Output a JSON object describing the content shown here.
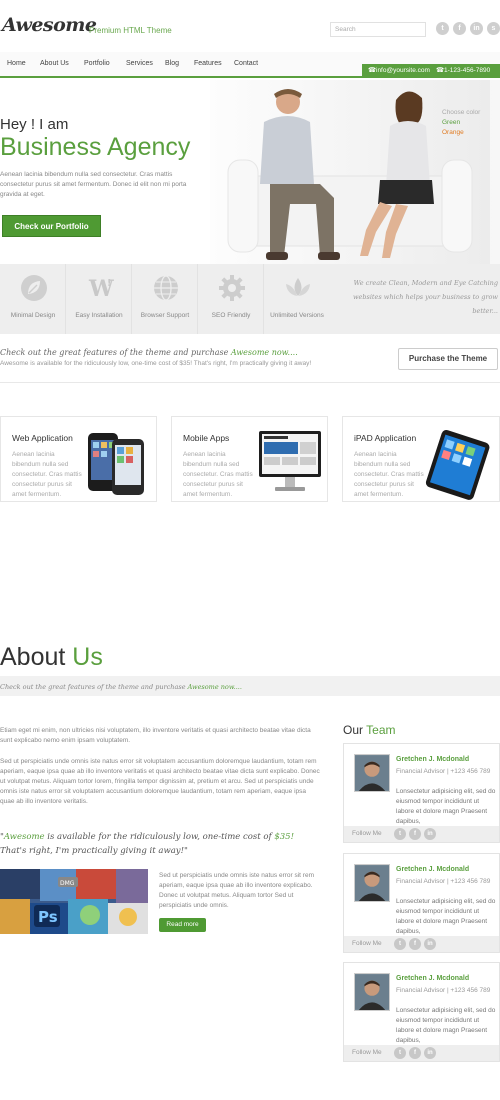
{
  "header": {
    "logo": "Awesome",
    "tagline": "Premium HTML Theme",
    "search_placeholder": "Search",
    "social": [
      "t",
      "f",
      "in",
      "s"
    ]
  },
  "nav": {
    "items": [
      "Home",
      "About Us",
      "Portfolio",
      "Services",
      "Blog",
      "Features",
      "Contact"
    ],
    "email": "info@yoursite.com",
    "phone": "1-123-456-7890"
  },
  "hero": {
    "greeting": "Hey ! I am",
    "title": "Business Agency",
    "text": "Aenean lacinia bibendum nulla sed consectetur. Cras mattis consectetur purus sit amet fermentum. Donec id elit non mi porta gravida at eget.",
    "button": "Check our Portfolio",
    "color_chooser": {
      "label": "Choose color",
      "options": [
        "Green",
        "Orange"
      ]
    }
  },
  "features": {
    "items": [
      {
        "label": "Minimal Design",
        "icon": "leaf-icon"
      },
      {
        "label": "Easy Installation",
        "icon": "wordpress-icon"
      },
      {
        "label": "Browser Support",
        "icon": "globe-icon"
      },
      {
        "label": "SEO Friendly",
        "icon": "gear-icon"
      },
      {
        "label": "Unlimited Versions",
        "icon": "lotus-icon"
      }
    ],
    "quote": "We create Clean, Modern and Eye Catching websites which helps your business to grow better..."
  },
  "purchase": {
    "heading_pre": "Check out the great features of the theme and purchase ",
    "heading_brand": "Awesome now....",
    "sub": "Awesome is available for the ridiculously low, one-time cost of $35! That's right, I'm practically giving it away!",
    "button": "Purchase the Theme"
  },
  "services": [
    {
      "title": "Web Application",
      "text": "Aenean lacinia bibendum nulla sed consectetur. Cras mattis consectetur purus sit amet fermentum.",
      "icon": "smartphone-icon"
    },
    {
      "title": "Mobile Apps",
      "text": "Aenean lacinia bibendum nulla sed consectetur. Cras mattis consectetur purus sit amet fermentum.",
      "icon": "monitor-icon"
    },
    {
      "title": "iPAD Application",
      "text": "Aenean lacinia bibendum nulla sed consectetur. Cras mattis consectetur purus sit amet fermentum.",
      "icon": "tablet-icon"
    }
  ],
  "about": {
    "title_a": "About",
    "title_b": "Us",
    "band_pre": "Check out the great features of the theme and purchase ",
    "band_brand": "Awesome now....",
    "para1": "Etiam eget mi enim, non ultricies nisi voluptatem, illo inventore veritatis et quasi architecto beatae vitae dicta sunt explicabo nemo enim ipsam voluptatem.",
    "para2": "Sed ut perspiciatis unde omnis iste natus error sit voluptatem accusantium doloremque laudantium, totam rem aperiam, eaque ipsa quae ab illo inventore veritatis et quasi architecto beatae vitae dicta sunt explicabo. Donec ut volutpat metus. Aliquam tortor lorem, fringilla tempor dignissim at, pretium et arcu. Sed ut perspiciatis unde omnis iste natus error sit voluptatem accusantium doloremque laudantium, totam rem aperiam, eaque ipsa quae ab illo inventore veritatis.",
    "quote_brand": "Awesome",
    "quote_mid": " is available for the ridiculously low, one-time cost of ",
    "quote_price": "$35!",
    "quote_end": " That's right, I'm practically giving it away!\"",
    "side_text": "Sed ut perspiciatis unde omnis iste natus error sit rem aperiam, eaque ipsa quae ab illo inventore explicabo. Donec ut volutpat metus. Aliquam tortor Sed ut perspiciatis unde omnis.",
    "read_more": "Read more"
  },
  "team": {
    "title_a": "Our",
    "title_b": "Team",
    "follow": "Follow Me",
    "members": [
      {
        "name": "Gretchen J. Mcdonald",
        "role": "Financial Advisor  | +123 456 789",
        "bio": "Lonsectetur adipisicing elit, sed do eiusmod tempor incididunt ut labore et dolore magn Praesent dapibus,"
      },
      {
        "name": "Gretchen J. Mcdonald",
        "role": "Financial Advisor  | +123 456 789",
        "bio": "Lonsectetur adipisicing elit, sed do eiusmod tempor incididunt ut labore et dolore magn Praesent dapibus,"
      },
      {
        "name": "Gretchen J. Mcdonald",
        "role": "Financial Advisor  | +123 456 789",
        "bio": "Lonsectetur adipisicing elit, sed do eiusmod tempor incididunt ut labore et dolore magn Praesent dapibus,"
      }
    ]
  },
  "colors": {
    "accent": "#5a9f3e",
    "button": "#4f9a33"
  }
}
